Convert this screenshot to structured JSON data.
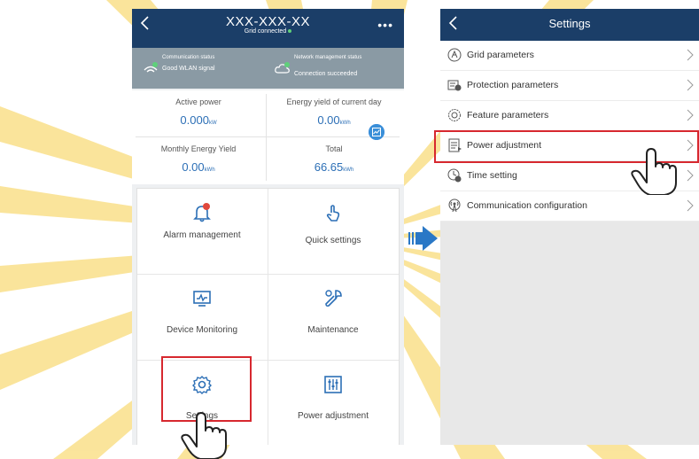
{
  "colors": {
    "header": "#1b3e68",
    "status_strip": "#8a9aa4",
    "accent_blue": "#2c6fb6",
    "highlight_red": "#d7282f",
    "watermark": "#f7cf4a"
  },
  "left_screen": {
    "device_name": "XXX-XXX-XX",
    "grid_status": "Grid connected",
    "more_icon": "more-icon",
    "status": [
      {
        "title": "Communication status",
        "value": "Good WLAN signal",
        "icon": "wifi-check-icon"
      },
      {
        "title": "Network management status",
        "value": "Connection succeeded",
        "icon": "cloud-check-icon"
      }
    ],
    "metrics": [
      {
        "label": "Active power",
        "value": "0.000",
        "unit": "kW"
      },
      {
        "label": "Energy yield of current day",
        "value": "0.00",
        "unit": "kWh"
      },
      {
        "label": "Monthly Energy Yield",
        "value": "0.00",
        "unit": "kWh"
      },
      {
        "label": "Total",
        "value": "66.65",
        "unit": "kWh"
      }
    ],
    "menu": [
      {
        "label": "Alarm management",
        "icon": "alarm-bell-icon"
      },
      {
        "label": "Quick settings",
        "icon": "touch-icon"
      },
      {
        "label": "Device Monitoring",
        "icon": "monitor-icon"
      },
      {
        "label": "Maintenance",
        "icon": "wrench-icon"
      },
      {
        "label": "Settings",
        "icon": "gear-icon"
      },
      {
        "label": "Power adjustment",
        "icon": "sliders-icon"
      }
    ]
  },
  "right_screen": {
    "title": "Settings",
    "items": [
      {
        "label": "Grid parameters",
        "icon": "grid-icon"
      },
      {
        "label": "Protection parameters",
        "icon": "protection-icon"
      },
      {
        "label": "Feature parameters",
        "icon": "feature-icon"
      },
      {
        "label": "Power adjustment",
        "icon": "document-icon"
      },
      {
        "label": "Time setting",
        "icon": "clock-icon"
      },
      {
        "label": "Communication configuration",
        "icon": "antenna-icon"
      }
    ]
  }
}
